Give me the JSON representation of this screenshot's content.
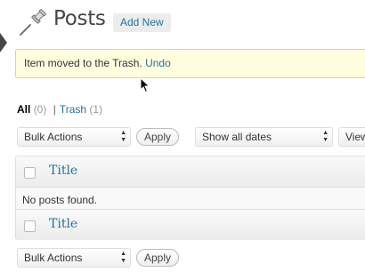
{
  "header": {
    "icon": "pushpin-icon",
    "title": "Posts",
    "add_new_label": "Add New"
  },
  "notice": {
    "message": "Item moved to the Trash.",
    "undo_label": "Undo"
  },
  "views": {
    "all_label": "All",
    "all_count": "(0)",
    "separator": "|",
    "trash_label": "Trash",
    "trash_count": "(1)"
  },
  "top_nav": {
    "bulk_actions_selected": "Bulk Actions",
    "apply_label": "Apply",
    "dates_selected": "Show all dates",
    "view_partial": "View"
  },
  "table": {
    "header_title": "Title",
    "empty_message": "No posts found.",
    "footer_title": "Title"
  },
  "bottom_nav": {
    "bulk_actions_selected": "Bulk Actions",
    "apply_label": "Apply"
  },
  "colors": {
    "link": "#21759b",
    "notice_bg": "#ffffe0",
    "notice_border": "#e6db55",
    "title": "#464646"
  }
}
